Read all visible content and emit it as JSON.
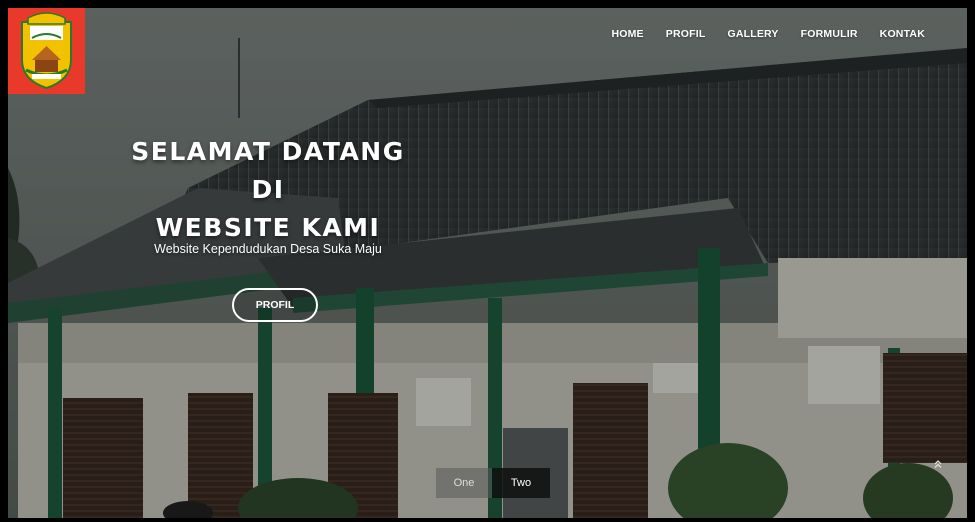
{
  "nav": {
    "items": [
      {
        "label": "HOME"
      },
      {
        "label": "PROFIL"
      },
      {
        "label": "GALLERY"
      },
      {
        "label": "FORMULIR"
      },
      {
        "label": "KONTAK"
      }
    ]
  },
  "hero": {
    "headline_line1": "SELAMAT DATANG DI",
    "headline_line2": "WEBSITE KAMI",
    "subtitle": "Website Kependudukan Desa Suka Maju",
    "button_label": "PROFIL"
  },
  "slider_tabs": [
    {
      "label": "One"
    },
    {
      "label": "Two",
      "active": true
    }
  ],
  "icons": {
    "logo": "regency-emblem-icon",
    "scroll_top": "chevron-double-up-icon"
  },
  "colors": {
    "logo_bg": "#e8392b",
    "active_tab": "#111111",
    "inactive_tab": "#5a5a5a"
  }
}
